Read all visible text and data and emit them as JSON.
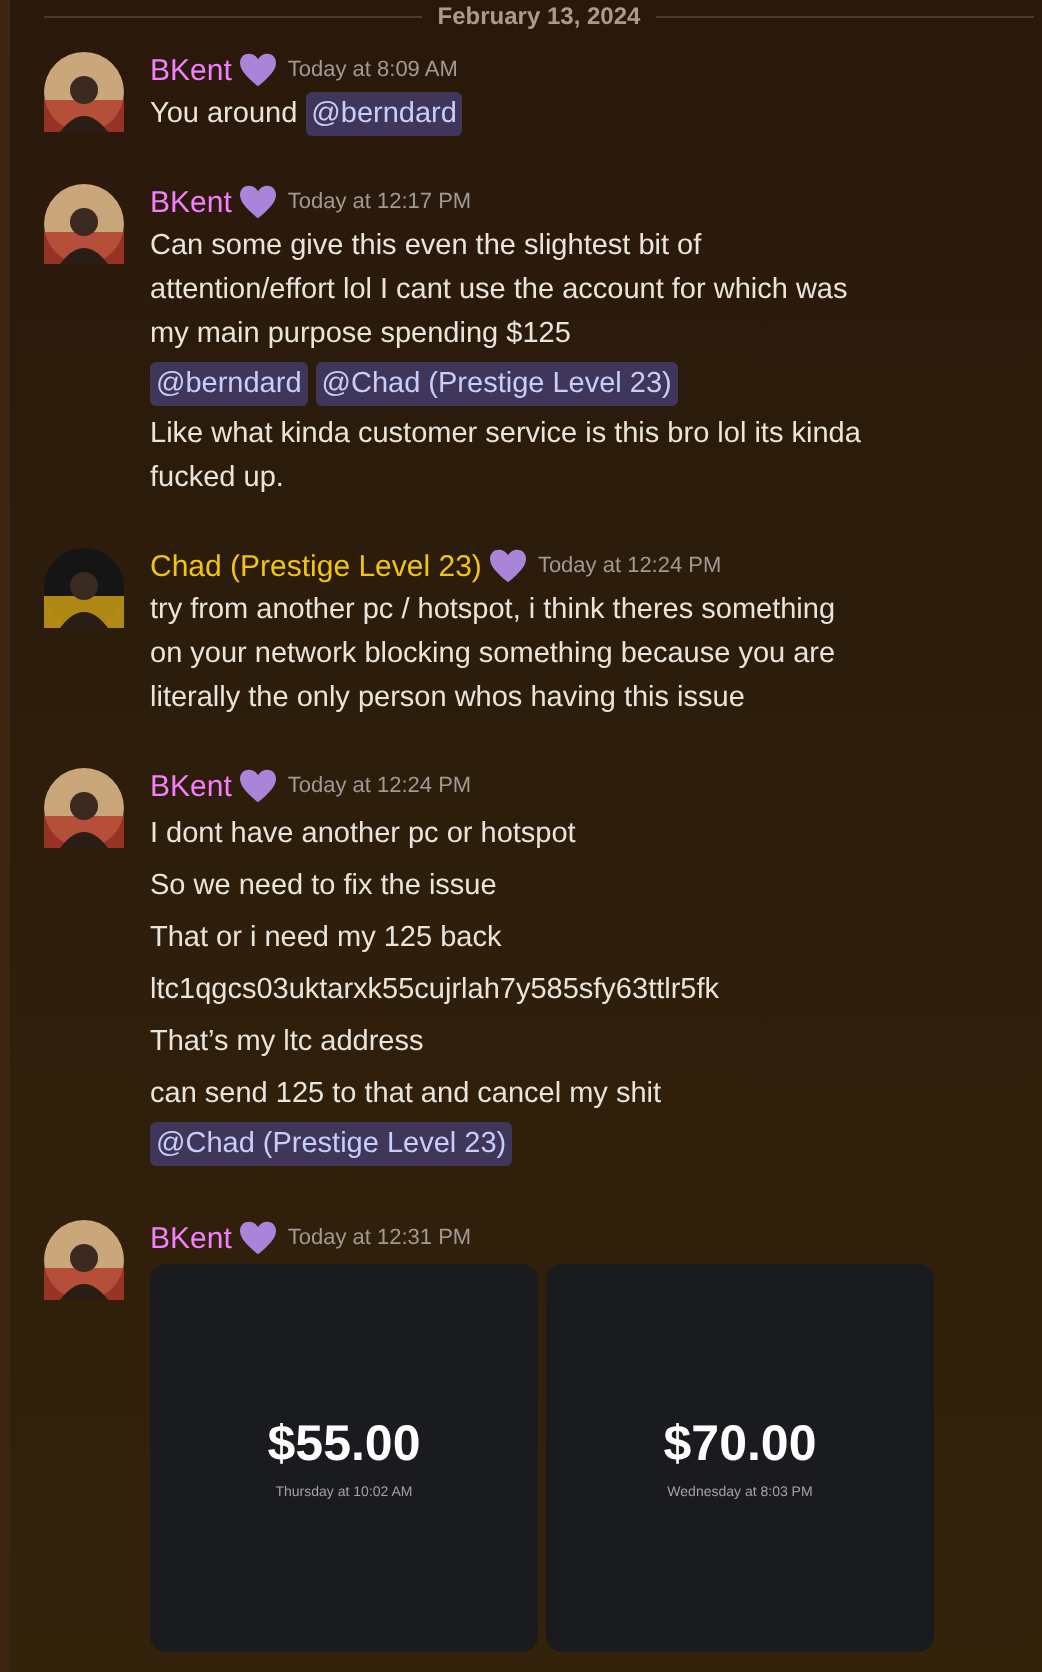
{
  "date_divider": "February 13, 2024",
  "messages": [
    {
      "author": "BKent",
      "color": "#f47fff",
      "avatar": {
        "kind": "light"
      },
      "time": "Today at 8:09 AM",
      "content": [
        {
          "kind": "text_mention",
          "text": "You around",
          "mention": "@berndard"
        }
      ]
    },
    {
      "author": "BKent",
      "color": "#f47fff",
      "avatar": {
        "kind": "light"
      },
      "time": "Today at 12:17 PM",
      "content": [
        {
          "kind": "text",
          "lines": [
            "Can some give this even the slightest bit of",
            "attention/effort lol I cant use the account for which was",
            "my main purpose spending $125"
          ]
        },
        {
          "kind": "mentions",
          "mentions": [
            "@berndard",
            "@Chad (Prestige Level 23)"
          ]
        },
        {
          "kind": "text",
          "lines": [
            "Like what kinda customer service is this bro lol its kinda",
            "fucked up."
          ]
        }
      ]
    },
    {
      "author": "Chad (Prestige Level 23)",
      "color": "#f1c40f",
      "avatar": {
        "kind": "dark"
      },
      "time": "Today at 12:24 PM",
      "content": [
        {
          "kind": "text",
          "lines": [
            "try from another pc / hotspot, i think theres something",
            "on your network blocking something because you are",
            "literally the only person whos having this issue"
          ]
        }
      ]
    },
    {
      "author": "BKent",
      "color": "#f47fff",
      "avatar": {
        "kind": "light"
      },
      "time": "Today at 12:24 PM",
      "content": [
        {
          "kind": "text",
          "lines": [
            "I dont have another pc or hotspot"
          ]
        },
        {
          "kind": "text",
          "lines": [
            "So we need to fix the issue"
          ]
        },
        {
          "kind": "text",
          "lines": [
            "That or i need my 125 back"
          ]
        },
        {
          "kind": "text",
          "lines": [
            "ltc1qgcs03uktarxk55cujrlah7y585sfy63ttlr5fk"
          ]
        },
        {
          "kind": "text",
          "lines": [
            "That’s my ltc address"
          ]
        },
        {
          "kind": "text",
          "lines": [
            "can send 125 to that and cancel my shit"
          ]
        },
        {
          "kind": "mentions",
          "mentions": [
            "@Chad (Prestige Level 23)"
          ]
        }
      ]
    },
    {
      "author": "BKent",
      "color": "#f47fff",
      "avatar": {
        "kind": "light"
      },
      "time": "Today at 12:31 PM",
      "content": [
        {
          "kind": "receipts",
          "cards": [
            {
              "amount": "$55.00",
              "date": "Thursday at 10:02 AM"
            },
            {
              "amount": "$70.00",
              "date": "Wednesday at 8:03 PM"
            }
          ]
        }
      ]
    }
  ]
}
